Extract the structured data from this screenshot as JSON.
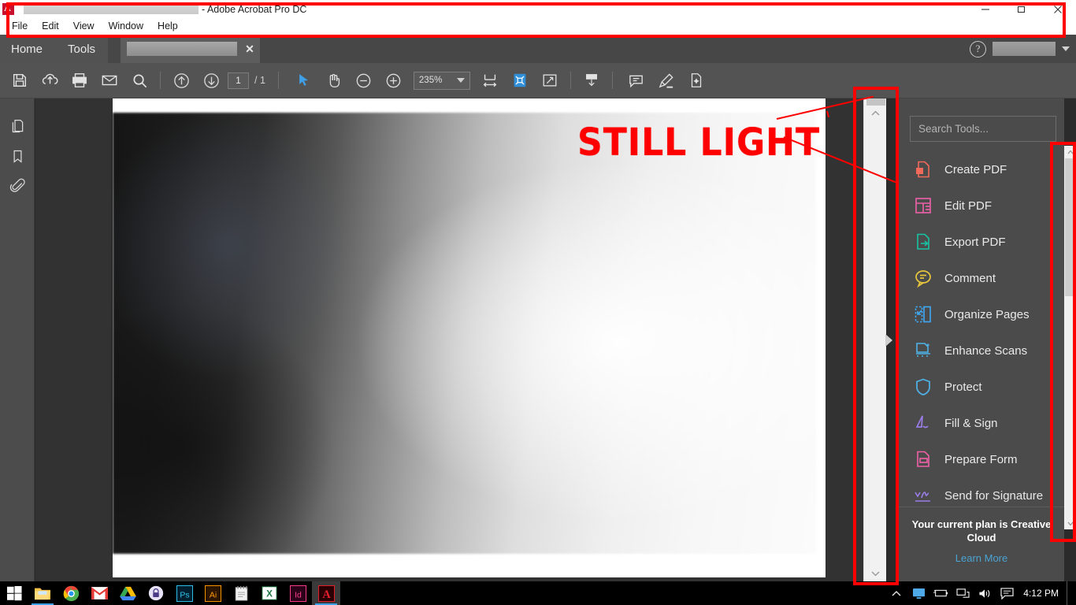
{
  "window": {
    "title_suffix": "- Adobe Acrobat Pro DC",
    "logo_letter": "A",
    "minimize": "─",
    "maximize": "❐",
    "close": "✕"
  },
  "menubar": {
    "items": [
      {
        "label": "File"
      },
      {
        "label": "Edit"
      },
      {
        "label": "View"
      },
      {
        "label": "Window"
      },
      {
        "label": "Help"
      }
    ]
  },
  "tabs": {
    "home": "Home",
    "tools": "Tools",
    "doc_close": "✕",
    "help_glyph": "?"
  },
  "toolbar": {
    "page_current": "1",
    "page_total": "/ 1",
    "zoom_value": "235%",
    "buttons": [
      {
        "name": "save-file",
        "label": "Save"
      },
      {
        "name": "upload-cloud",
        "label": "Save to cloud"
      },
      {
        "name": "print",
        "label": "Print"
      },
      {
        "name": "email",
        "label": "Email"
      },
      {
        "name": "search",
        "label": "Find"
      },
      {
        "name": "previous-page",
        "label": "Previous Page"
      },
      {
        "name": "next-page",
        "label": "Next Page"
      },
      {
        "name": "select-tool",
        "label": "Select"
      },
      {
        "name": "hand-tool",
        "label": "Hand Tool"
      },
      {
        "name": "zoom-out",
        "label": "Zoom Out"
      },
      {
        "name": "zoom-in",
        "label": "Zoom In"
      },
      {
        "name": "fit-width",
        "label": "Fit Width"
      },
      {
        "name": "fit-page",
        "label": "Fit Page"
      },
      {
        "name": "fullscreen",
        "label": "Read Mode"
      },
      {
        "name": "scroll-snapshot",
        "label": "Snapshot"
      },
      {
        "name": "comment",
        "label": "Comment"
      },
      {
        "name": "highlight",
        "label": "Highlight Text"
      },
      {
        "name": "add-page",
        "label": "Add"
      }
    ]
  },
  "leftrail": {
    "items": [
      {
        "name": "page-thumbnails",
        "label": "Page Thumbnails"
      },
      {
        "name": "bookmarks",
        "label": "Bookmarks"
      },
      {
        "name": "attachments",
        "label": "Attachments"
      }
    ]
  },
  "document": {
    "overlay_text": "STILL LIGHT"
  },
  "toolspanel": {
    "search_placeholder": "Search Tools...",
    "items": [
      {
        "label": "Create PDF",
        "icon": "create-pdf-icon",
        "color": "#ef6a5a"
      },
      {
        "label": "Edit PDF",
        "icon": "edit-pdf-icon",
        "color": "#ef60a8"
      },
      {
        "label": "Export PDF",
        "icon": "export-pdf-icon",
        "color": "#17c3a2"
      },
      {
        "label": "Comment",
        "icon": "comment-icon",
        "color": "#e8c63c"
      },
      {
        "label": "Organize Pages",
        "icon": "organize-pages-icon",
        "color": "#3fa9f5"
      },
      {
        "label": "Enhance Scans",
        "icon": "enhance-scans-icon",
        "color": "#4fb3e8"
      },
      {
        "label": "Protect",
        "icon": "protect-icon",
        "color": "#4fb3e8"
      },
      {
        "label": "Fill & Sign",
        "icon": "fill-and-sign-icon",
        "color": "#9b7de8"
      },
      {
        "label": "Prepare Form",
        "icon": "prepare-form-icon",
        "color": "#ef60a8"
      },
      {
        "label": "Send for Signature",
        "icon": "send-for-signature-icon",
        "color": "#9b7de8"
      }
    ],
    "plan_text": "Your current plan is Creative Cloud",
    "learn_more": "Learn More"
  },
  "taskbar": {
    "start": "start-button",
    "apps": [
      {
        "name": "file-explorer",
        "label": "File Explorer"
      },
      {
        "name": "google-chrome",
        "label": "Google Chrome"
      },
      {
        "name": "gmail",
        "label": "Gmail"
      },
      {
        "name": "google-drive",
        "label": "Google Drive"
      },
      {
        "name": "lock-app",
        "label": "Lock"
      },
      {
        "name": "photoshop",
        "label": "Ps"
      },
      {
        "name": "illustrator",
        "label": "Ai"
      },
      {
        "name": "notepad",
        "label": "Notepad"
      },
      {
        "name": "excel",
        "label": "Excel"
      },
      {
        "name": "indesign",
        "label": "Id"
      },
      {
        "name": "acrobat",
        "label": "Acrobat"
      }
    ],
    "tray": [
      {
        "name": "show-hidden-icons",
        "label": "^"
      },
      {
        "name": "display-icon",
        "label": "Display"
      },
      {
        "name": "battery-icon",
        "label": "Battery"
      },
      {
        "name": "network-icon",
        "label": "Network"
      },
      {
        "name": "volume-icon",
        "label": "Volume"
      },
      {
        "name": "action-center-icon",
        "label": "Notifications"
      }
    ],
    "clock": "4:12 PM"
  }
}
